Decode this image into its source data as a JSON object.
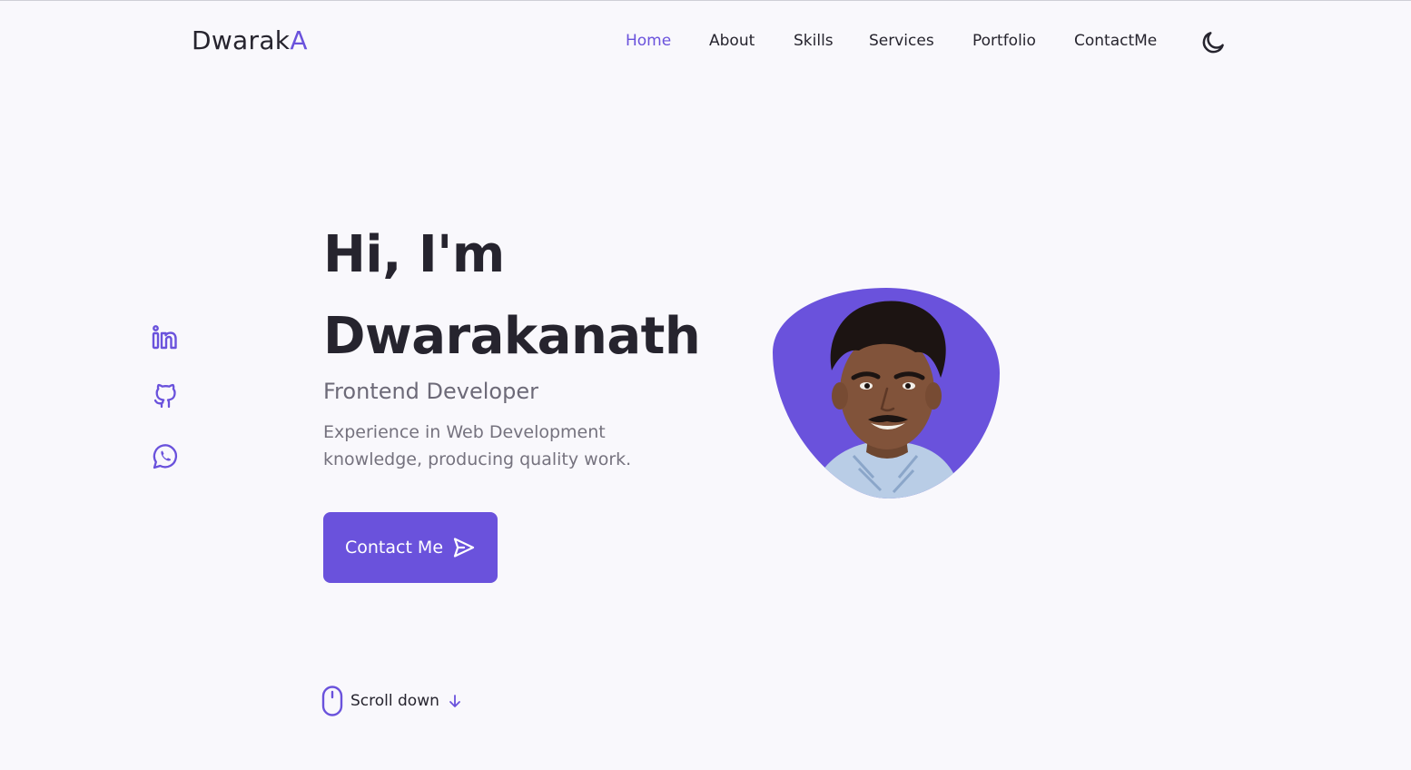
{
  "brand": {
    "name": "Dwarak",
    "accent_letter": "A"
  },
  "nav": {
    "items": [
      {
        "label": "Home",
        "active": true
      },
      {
        "label": "About",
        "active": false
      },
      {
        "label": "Skills",
        "active": false
      },
      {
        "label": "Services",
        "active": false
      },
      {
        "label": "Portfolio",
        "active": false
      },
      {
        "label": "ContactMe",
        "active": false
      }
    ],
    "theme_toggle_icon": "moon-icon"
  },
  "socials": [
    {
      "name": "linkedin",
      "icon": "linkedin-icon"
    },
    {
      "name": "github",
      "icon": "github-icon"
    },
    {
      "name": "whatsapp",
      "icon": "whatsapp-icon"
    }
  ],
  "hero": {
    "greeting": "Hi, I'm",
    "name": "Dwarakanath",
    "subtitle": "Frontend Developer",
    "description": "Experience in Web Development knowledge, producing quality work.",
    "cta_label": "Contact Me",
    "cta_icon": "send-icon",
    "avatar_icon": "profile-photo"
  },
  "scroll": {
    "label": "Scroll down",
    "icon": "mouse-icon",
    "arrow_icon": "arrow-down-icon"
  },
  "colors": {
    "accent": "#6a52dc",
    "text": "#26242e",
    "muted": "#6d6a78",
    "background": "#f9f8fc"
  }
}
